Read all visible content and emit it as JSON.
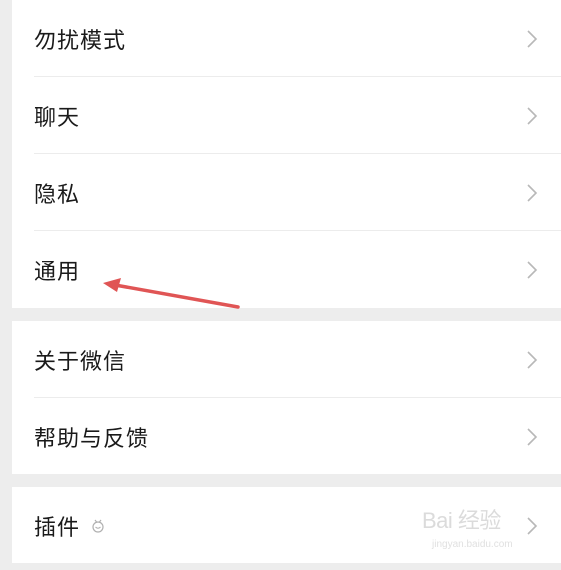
{
  "settings": {
    "group1": [
      {
        "label": "勿扰模式"
      },
      {
        "label": "聊天"
      },
      {
        "label": "隐私"
      },
      {
        "label": "通用"
      }
    ],
    "group2": [
      {
        "label": "关于微信"
      },
      {
        "label": "帮助与反馈"
      }
    ],
    "group3": [
      {
        "label": "插件",
        "icon": "plugin-icon"
      }
    ]
  },
  "annotation": {
    "arrow_color": "#e05555",
    "points_to": "通用"
  },
  "watermark": {
    "main": "Bai 经验",
    "sub": "jingyan.baidu.com"
  },
  "colors": {
    "background": "#ededed",
    "row_background": "#ffffff",
    "text": "#1a1a1a",
    "chevron": "#b8b8b8"
  }
}
